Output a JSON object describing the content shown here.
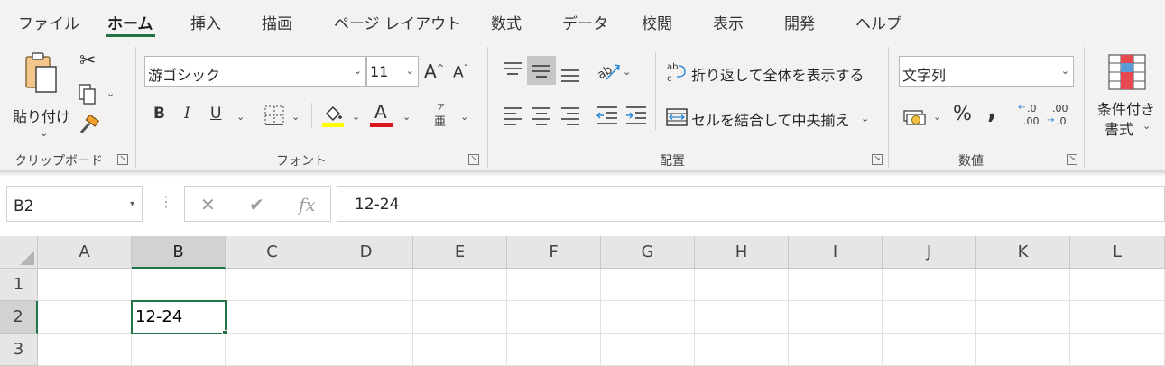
{
  "tabs": [
    {
      "label": "ファイル"
    },
    {
      "label": "ホーム"
    },
    {
      "label": "挿入"
    },
    {
      "label": "描画"
    },
    {
      "label": "ページ レイアウト"
    },
    {
      "label": "数式"
    },
    {
      "label": "データ"
    },
    {
      "label": "校閲"
    },
    {
      "label": "表示"
    },
    {
      "label": "開発"
    },
    {
      "label": "ヘルプ"
    }
  ],
  "active_tab": "ホーム",
  "clipboard": {
    "paste_label": "貼り付け",
    "group_label": "クリップボード"
  },
  "font": {
    "font_name": "游ゴシック",
    "font_size": "11",
    "bold": "B",
    "italic": "I",
    "underline": "U",
    "grow": "A",
    "shrink": "A",
    "phonetic": "亜",
    "group_label": "フォント",
    "highlight_color": "#ffff00",
    "font_color": "#ff0000"
  },
  "alignment": {
    "wrap_text_label": "折り返して全体を表示する",
    "merge_center_label": "セルを結合して中央揃え",
    "group_label": "配置"
  },
  "number": {
    "format": "文字列",
    "percent": "%",
    "comma": ",",
    "inc_decimal_top": ".0",
    "inc_decimal_bottom": ".00",
    "dec_decimal_top": ".00",
    "dec_decimal_bottom": ".0",
    "group_label": "数値"
  },
  "styles": {
    "conditional_line1": "条件付き",
    "conditional_line2": "書式"
  },
  "formula_bar": {
    "name_box": "B2",
    "fx": "fx",
    "content": "12-24"
  },
  "columns": [
    "A",
    "B",
    "C",
    "D",
    "E",
    "F",
    "G",
    "H",
    "I",
    "J",
    "K",
    "L"
  ],
  "rows": [
    "1",
    "2",
    "3"
  ],
  "selected_column": "B",
  "selected_row": "2",
  "cells": {
    "B2": "12-24"
  },
  "colors": {
    "accent": "#217346"
  }
}
